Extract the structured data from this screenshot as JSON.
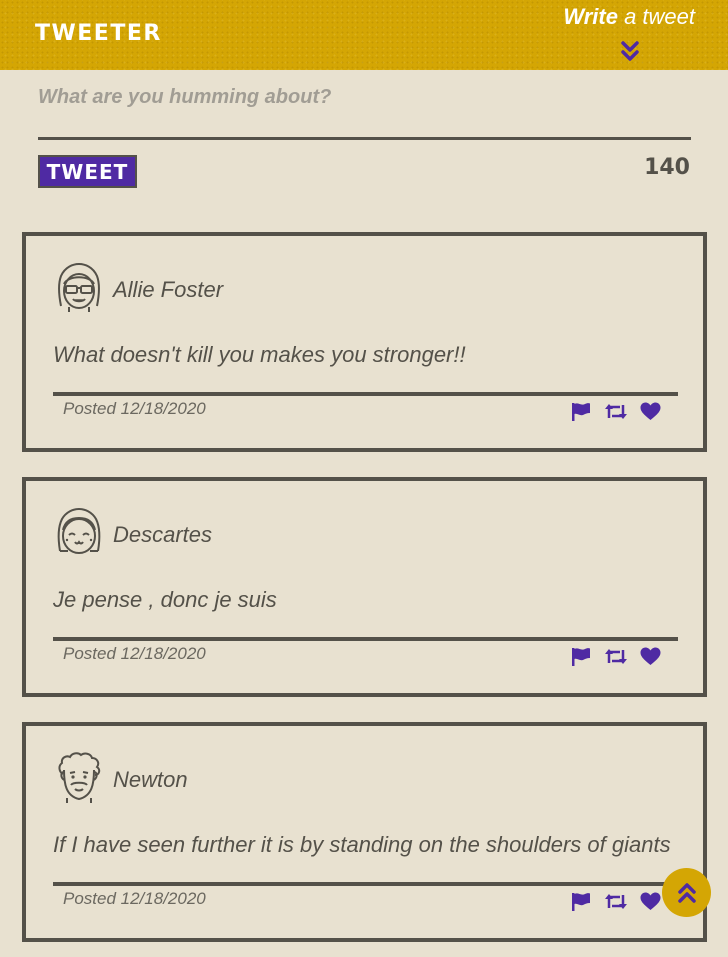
{
  "nav": {
    "brand": "TWEETER",
    "write_bold": "Write",
    "write_rest": "a tweet"
  },
  "compose": {
    "placeholder": "What are you humming about?",
    "button_label": "TWEET",
    "counter": "140"
  },
  "tweets": [
    {
      "author": "Allie Foster",
      "content": "What doesn't kill you makes you stronger!!",
      "posted": "Posted 12/18/2020",
      "avatar_icon": "girl-sunglasses-avatar-icon"
    },
    {
      "author": "Descartes",
      "content": "Je pense , donc je suis",
      "posted": "Posted 12/18/2020",
      "avatar_icon": "girl-bangs-avatar-icon"
    },
    {
      "author": "Newton",
      "content": "If I have seen further it is by standing on the shoulders of giants",
      "posted": "Posted 12/18/2020",
      "avatar_icon": "curly-hair-avatar-icon"
    }
  ],
  "icons": {
    "flag": "flag-icon",
    "retweet": "retweet-icon",
    "like": "heart-icon",
    "write_toggle": "chevron-double-down-icon",
    "back_to_top": "chevron-double-up-icon"
  },
  "colors": {
    "nav_background": "#d4a604",
    "page_background": "#e8e1d0",
    "accent_purple": "#4f2aa3",
    "text_dark": "#545149",
    "placeholder": "#a19d94"
  }
}
